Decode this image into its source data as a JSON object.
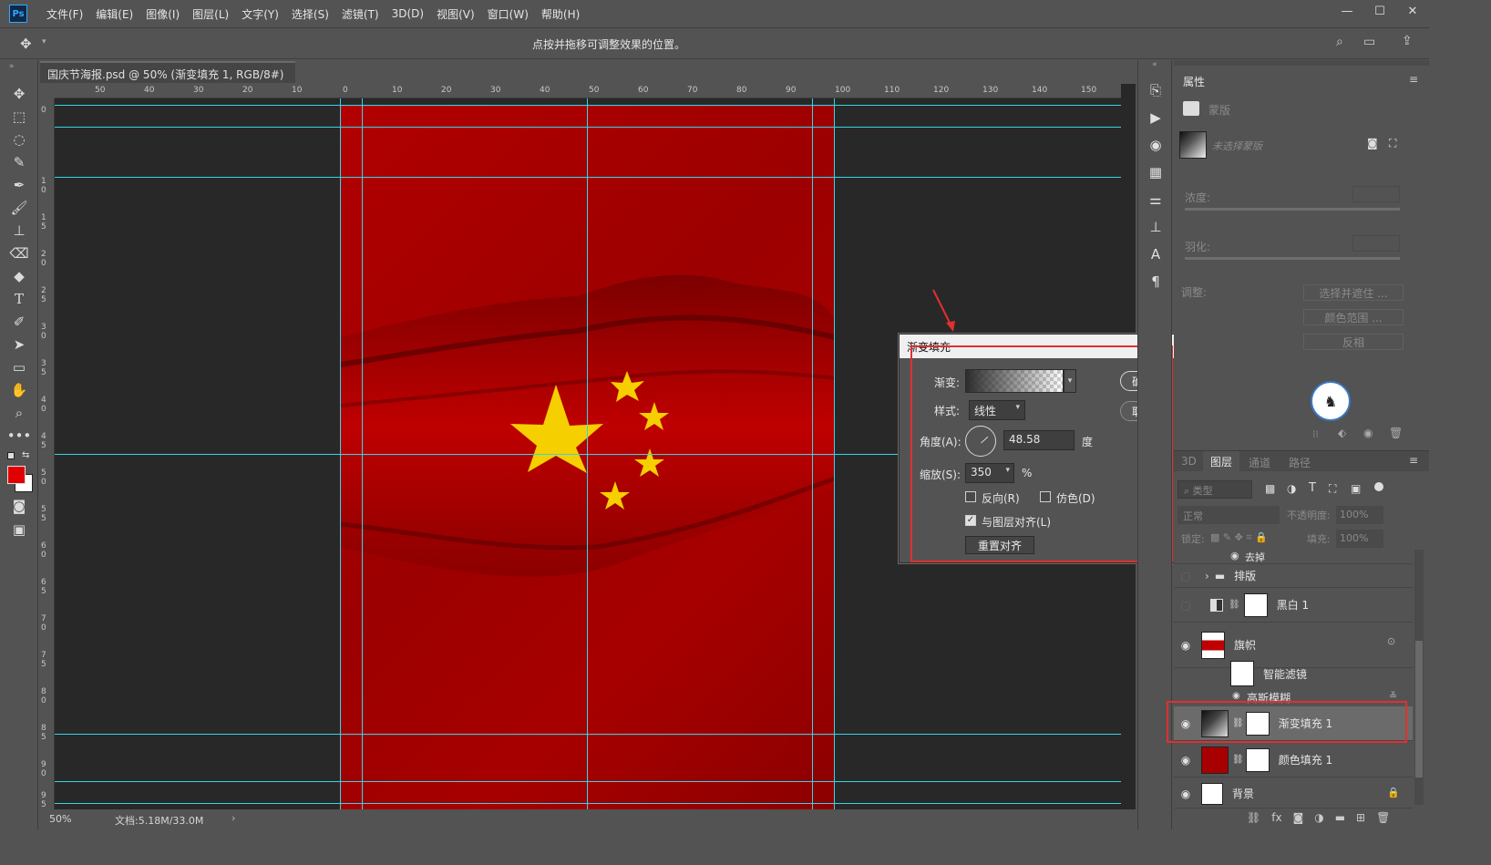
{
  "app": {
    "logo": "Ps"
  },
  "menu": [
    "文件(F)",
    "编辑(E)",
    "图像(I)",
    "图层(L)",
    "文字(Y)",
    "选择(S)",
    "滤镜(T)",
    "3D(D)",
    "视图(V)",
    "窗口(W)",
    "帮助(H)"
  ],
  "options": {
    "hint": "点按并拖移可调整效果的位置。"
  },
  "tab": {
    "title": "国庆节海报.psd @ 50% (渐变填充 1, RGB/8#) *",
    "close": "×"
  },
  "ruler_h": [
    "50",
    "40",
    "30",
    "20",
    "10",
    "0",
    "10",
    "20",
    "30",
    "40",
    "50",
    "60",
    "70",
    "80",
    "90",
    "100",
    "110",
    "120",
    "130",
    "140",
    "150"
  ],
  "ruler_v": [
    "0",
    "1 0",
    "1 5",
    "2 0",
    "2 5",
    "3 0",
    "3 5",
    "4 0",
    "4 5",
    "5 0",
    "5 5",
    "6 0",
    "6 5",
    "7 0",
    "7 5",
    "8 0",
    "8 5",
    "9 0",
    "9 5"
  ],
  "status": {
    "zoom": "50%",
    "doc": "文档:5.18M/33.0M"
  },
  "dialog": {
    "title": "渐变填充",
    "gradient_label": "渐变:",
    "style_label": "样式:",
    "style_value": "线性",
    "angle_label": "角度(A):",
    "angle_value": "48.58",
    "angle_unit": "度",
    "scale_label": "缩放(S):",
    "scale_value": "350",
    "scale_unit": "%",
    "reverse": "反向(R)",
    "dither": "仿色(D)",
    "align": "与图层对齐(L)",
    "reset": "重置对齐",
    "ok": "确定",
    "cancel": "取消"
  },
  "props": {
    "title": "属性",
    "mask": "蒙版",
    "no_mask": "未选择蒙版",
    "density": "浓度:",
    "feather": "羽化:",
    "adjust": "调整:",
    "btn_select": "选择并遮住 ...",
    "btn_color": "颜色范围 ...",
    "btn_invert": "反相"
  },
  "layers_panel": {
    "tabs": [
      "3D",
      "图层",
      "通道",
      "路径"
    ],
    "filter": "类型",
    "blend": "正常",
    "opacity_label": "不透明度:",
    "opacity": "100%",
    "lock_label": "锁定:",
    "fill_label": "填充:",
    "fill": "100%",
    "effect_partial": "去掉"
  },
  "layers": [
    {
      "name": "排版",
      "kind": "group"
    },
    {
      "name": "黑白 1",
      "kind": "adjust"
    },
    {
      "name": "旗帜",
      "kind": "smart"
    },
    {
      "name": "智能滤镜",
      "kind": "filter"
    },
    {
      "name": "高斯模糊",
      "kind": "filteritem"
    },
    {
      "name": "渐变填充 1",
      "kind": "gradient"
    },
    {
      "name": "颜色填充 1",
      "kind": "color"
    },
    {
      "name": "背景",
      "kind": "bg"
    }
  ],
  "colors": {
    "fg": "#e00000",
    "bg": "#ffffff",
    "canvas": "#a80000",
    "star": "#f6cf00",
    "guide": "#34d6e6",
    "highlight": "#e03030"
  }
}
